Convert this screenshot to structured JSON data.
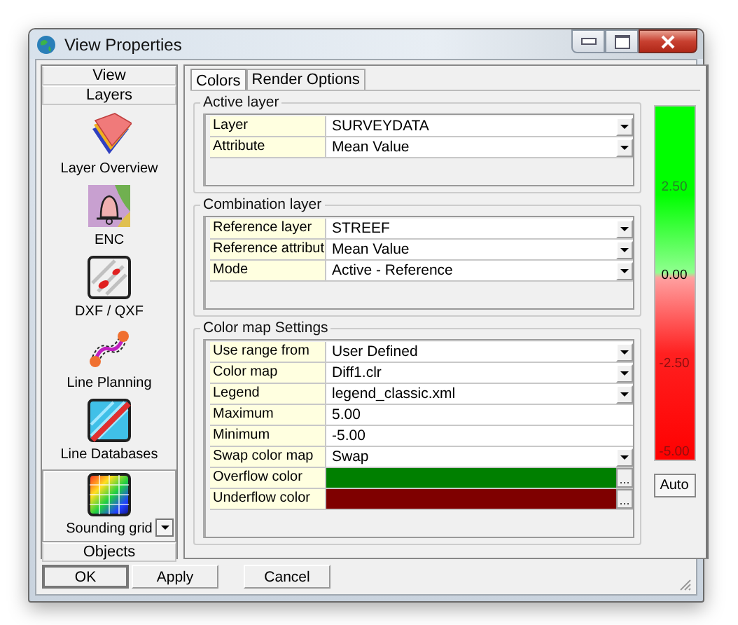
{
  "window": {
    "title": "View Properties"
  },
  "sidebar": {
    "headers": [
      "View",
      "Layers"
    ],
    "items": [
      {
        "label": "Layer Overview",
        "kind": "layers",
        "selected": false
      },
      {
        "label": "ENC",
        "kind": "enc",
        "selected": false
      },
      {
        "label": "DXF / QXF",
        "kind": "dxf",
        "selected": false
      },
      {
        "label": "Line Planning",
        "kind": "planning",
        "selected": false
      },
      {
        "label": "Line Databases",
        "kind": "database",
        "selected": false
      },
      {
        "label": "Sounding grid",
        "kind": "grid",
        "selected": true
      }
    ],
    "footers": [
      "Objects"
    ]
  },
  "tabs": [
    {
      "label": "Colors",
      "selected": true
    },
    {
      "label": "Render Options",
      "selected": false
    }
  ],
  "groups": [
    {
      "title": "Active layer",
      "rows": [
        {
          "label": "Layer",
          "value": "SURVEYDATA",
          "kind": "dropdown"
        },
        {
          "label": "Attribute",
          "value": "Mean Value",
          "kind": "dropdown"
        }
      ]
    },
    {
      "title": "Combination layer",
      "rows": [
        {
          "label": "Reference layer",
          "value": "STREEF",
          "kind": "dropdown"
        },
        {
          "label": "Reference attribut",
          "value": "Mean Value",
          "kind": "dropdown"
        },
        {
          "label": "Mode",
          "value": "Active - Reference",
          "kind": "dropdown"
        }
      ]
    },
    {
      "title": "Color map Settings",
      "rows": [
        {
          "label": "Use range from",
          "value": "User Defined",
          "kind": "dropdown"
        },
        {
          "label": "Color map",
          "value": "Diff1.clr",
          "kind": "dropdown"
        },
        {
          "label": "Legend",
          "value": "legend_classic.xml",
          "kind": "dropdown"
        },
        {
          "label": "Maximum",
          "value": "5.00",
          "kind": "text"
        },
        {
          "label": "Minimum",
          "value": "-5.00",
          "kind": "text"
        },
        {
          "label": "Swap color map",
          "value": "Swap",
          "kind": "dropdown"
        },
        {
          "label": "Overflow color",
          "color": "#007f00",
          "button": "...",
          "kind": "color"
        },
        {
          "label": "Underflow color",
          "color": "#7f0000",
          "button": "...",
          "kind": "color"
        }
      ]
    }
  ],
  "legend": {
    "labels": [
      "2.50",
      "0.00",
      "-2.50",
      "-5.00"
    ],
    "button": "Auto"
  },
  "buttons": [
    {
      "label": "OK",
      "default": true
    },
    {
      "label": "Apply",
      "default": false
    },
    {
      "label": "Cancel",
      "default": false
    }
  ]
}
